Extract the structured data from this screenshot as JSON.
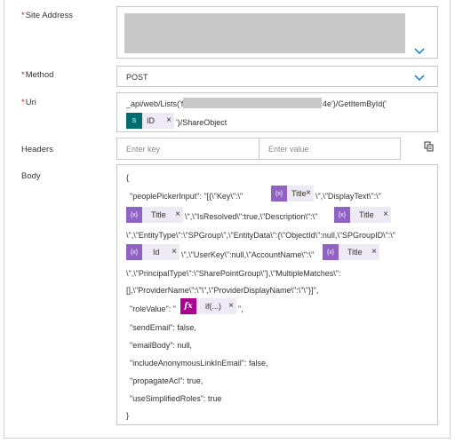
{
  "site_address": {
    "label": "Site Address",
    "required_mark": "*"
  },
  "method": {
    "label": "Method",
    "required_mark": "*",
    "value": "POST"
  },
  "uri": {
    "label": "Uri",
    "required_mark": "*",
    "line1_prefix": "_api/web/Lists('f01",
    "line1_suffix": "4e')/GetItemById('",
    "token": {
      "icon": "sharepoint-icon",
      "label": "ID",
      "close": "×"
    },
    "line2_suffix": "')/ShareObject"
  },
  "headers": {
    "label": "Headers",
    "key_placeholder": "Enter key",
    "value_placeholder": "Enter value",
    "mode_icon": "switch-to-text-mode-icon"
  },
  "body": {
    "label": "Body",
    "lines": {
      "open_brace": "{",
      "l2_a": "\"peoplePickerInput\": \"[{\\\"Key\\\":\\\"",
      "l2_b": "\\\",\\\"DisplayText\\\":\\\"",
      "l3_b": "\\\",\\\"IsResolved\\\":true,\\\"Description\\\":\\\"",
      "l4": "\\\",\\\"EntityType\\\":\\\"SPGroup\\\",\\\"EntityData\\\":{\\\"ObjectId\\\":null,\\\"SPGroupID\\\":\\\"",
      "l5_b": "\\\",\\\"UserKey\\\":null,\\\"AccountName\\\":\\\"",
      "l6": "\\\",\\\"PrincipalType\\\":\\\"SharePointGroup\\\"},\\\"MultipleMatches\\\":",
      "l7": "[],\\\"ProviderName\\\":\\\"\\\",\\\"ProviderDisplayName\\\":\\\"\\\"}]\",",
      "l8_a": "\"roleValue\": \"",
      "l8_b": "\",",
      "l9": "\"sendEmail\": false,",
      "l10": "\"emailBody\": null,",
      "l11": "\"includeAnonymousLinkInEmail\": false,",
      "l12": "\"propagateAcl\": true,",
      "l13": "\"useSimplifiedRoles\": true",
      "close_brace": "}"
    },
    "tokens": {
      "title": "Title",
      "id": "Id",
      "fx": "if(...)",
      "close": "×",
      "var_icon_text": "{x}",
      "fx_icon_text": "fx"
    }
  },
  "colors": {
    "variable_token": "#8f62c4",
    "sharepoint_token": "#036c70",
    "expression_token": "#ad008c",
    "token_background": "#eeeaf5",
    "required_mark": "#a4262c",
    "accent": "#0078d4"
  }
}
